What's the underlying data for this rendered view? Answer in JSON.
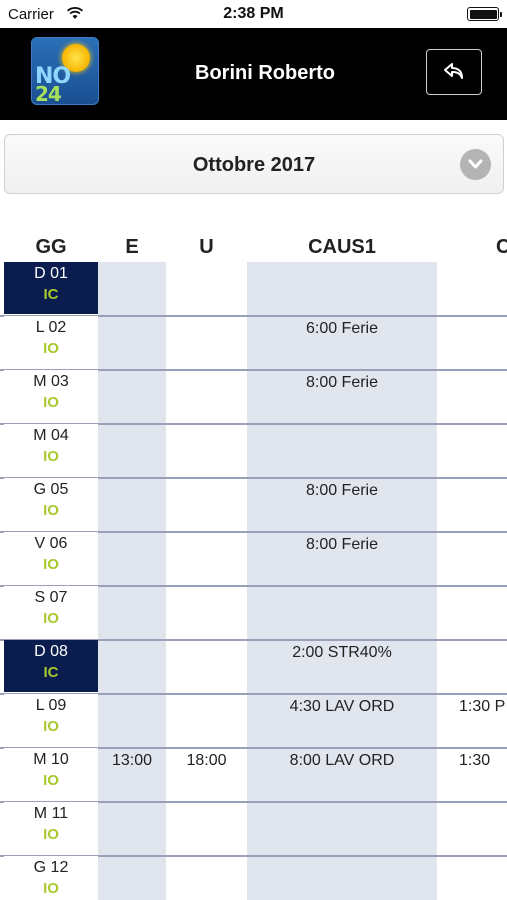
{
  "status_bar": {
    "carrier": "Carrier",
    "time": "2:38 PM"
  },
  "header": {
    "title": "Borini Roberto",
    "logo_text_top": "NO",
    "logo_text_bottom": "24"
  },
  "month": {
    "label": "Ottobre 2017"
  },
  "table": {
    "columns": [
      "GG",
      "E",
      "U",
      "CAUS1",
      "C"
    ],
    "rows": [
      {
        "day": "D 01",
        "code": "IC",
        "sunday": true,
        "e": "",
        "u": "",
        "caus1": "",
        "c": ""
      },
      {
        "day": "L 02",
        "code": "IO",
        "sunday": false,
        "e": "",
        "u": "",
        "caus1": "6:00 Ferie",
        "c": ""
      },
      {
        "day": "M 03",
        "code": "IO",
        "sunday": false,
        "e": "",
        "u": "",
        "caus1": "8:00 Ferie",
        "c": ""
      },
      {
        "day": "M 04",
        "code": "IO",
        "sunday": false,
        "e": "",
        "u": "",
        "caus1": "",
        "c": ""
      },
      {
        "day": "G 05",
        "code": "IO",
        "sunday": false,
        "e": "",
        "u": "",
        "caus1": "8:00 Ferie",
        "c": ""
      },
      {
        "day": "V 06",
        "code": "IO",
        "sunday": false,
        "e": "",
        "u": "",
        "caus1": "8:00 Ferie",
        "c": ""
      },
      {
        "day": "S 07",
        "code": "IO",
        "sunday": false,
        "e": "",
        "u": "",
        "caus1": "",
        "c": ""
      },
      {
        "day": "D 08",
        "code": "IC",
        "sunday": true,
        "e": "",
        "u": "",
        "caus1": "2:00 STR40%",
        "c": ""
      },
      {
        "day": "L 09",
        "code": "IO",
        "sunday": false,
        "e": "",
        "u": "",
        "caus1": "4:30 LAV ORD",
        "c": "1:30 P"
      },
      {
        "day": "M 10",
        "code": "IO",
        "sunday": false,
        "e": "13:00",
        "u": "18:00",
        "caus1": "8:00 LAV ORD",
        "c": "1:30"
      },
      {
        "day": "M 11",
        "code": "IO",
        "sunday": false,
        "e": "",
        "u": "",
        "caus1": "",
        "c": ""
      },
      {
        "day": "G 12",
        "code": "IO",
        "sunday": false,
        "e": "",
        "u": "",
        "caus1": "",
        "c": ""
      }
    ]
  },
  "colors": {
    "header_bg": "#000000",
    "sunday_bg": "#0b1d4f",
    "code_green": "#a7c92b",
    "column_shade": "#e1e5ee"
  },
  "icons": {
    "back": "reply-arrow-icon",
    "dropdown": "chevron-down-icon",
    "wifi": "wifi-icon",
    "battery": "battery-icon"
  }
}
